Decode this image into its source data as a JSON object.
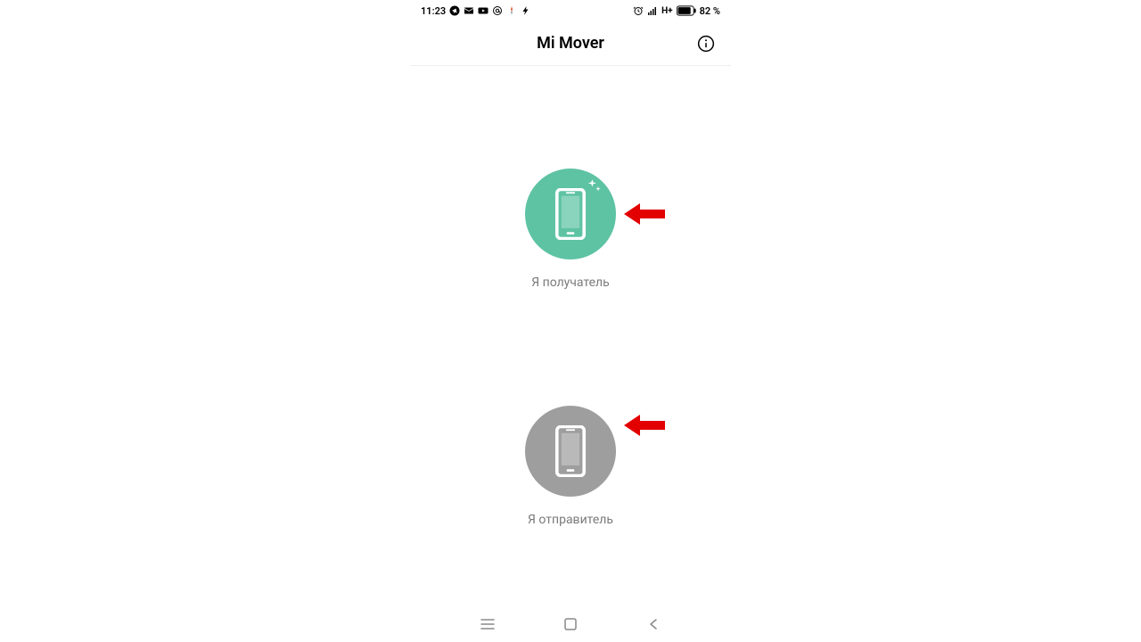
{
  "status_bar": {
    "time": "11:23",
    "network": "H+",
    "battery": "82 %"
  },
  "header": {
    "title": "Mi Mover"
  },
  "options": {
    "receiver_label": "Я получатель",
    "sender_label": "Я отправитель"
  },
  "colors": {
    "receiver_bg": "#5ec3a3",
    "sender_bg": "#9e9e9e",
    "arrow": "#e20000"
  }
}
